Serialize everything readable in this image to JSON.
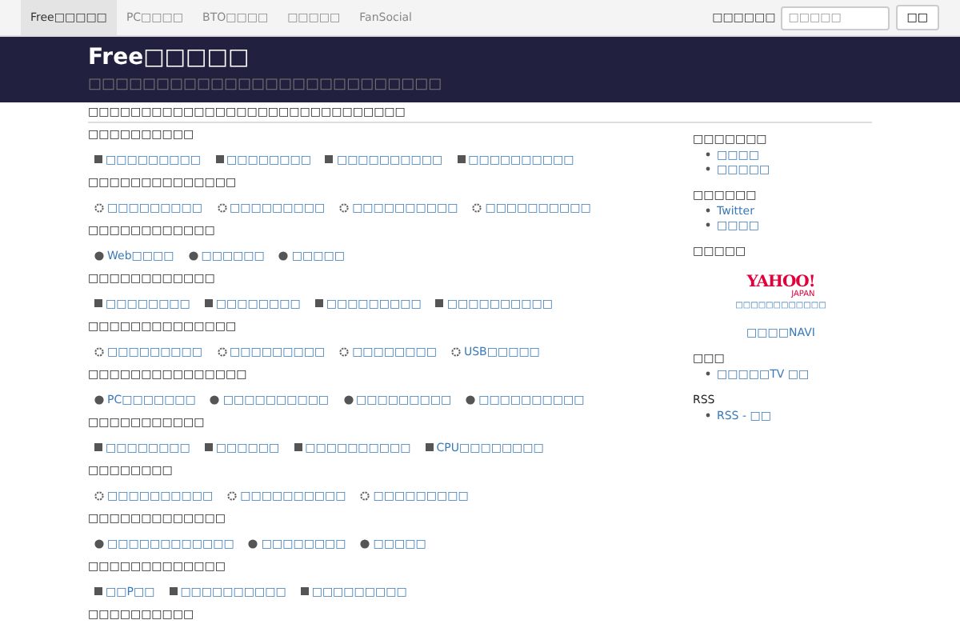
{
  "navbar": {
    "items": [
      {
        "label": "Free□□□□□",
        "selected": true
      },
      {
        "label": "PC□□□□",
        "selected": false
      },
      {
        "label": "BTO□□□□",
        "selected": false
      },
      {
        "label": "□□□□□",
        "selected": false
      },
      {
        "label": "FanSocial",
        "selected": false
      }
    ],
    "search": {
      "label": "□□□□□□",
      "placeholder": "□□□□□",
      "button": "□□"
    }
  },
  "header": {
    "title": "Free□□□□□",
    "subtitle": "□□□□□□□□□□□□□□□□□□□□□□□□□□"
  },
  "tagline": "□□□□□□□□□□□□□□□□□□□□□□□□□□□□□□",
  "sections": [
    {
      "heading": "□□□□□□□□□□",
      "kind": "square",
      "links": [
        "□□□□□□□□□",
        "□□□□□□□□",
        "□□□□□□□□□□",
        "□□□□□□□□□□"
      ]
    },
    {
      "heading": "□□□□□□□□□□□□□□",
      "kind": "ring",
      "links": [
        "□□□□□□□□□",
        "□□□□□□□□□",
        "□□□□□□□□□□",
        "□□□□□□□□□□"
      ]
    },
    {
      "heading": "□□□□□□□□□□□□",
      "kind": "dot",
      "links": [
        "Web□□□□",
        "□□□□□□",
        "□□□□□"
      ]
    },
    {
      "heading": "□□□□□□□□□□□□",
      "kind": "square",
      "links": [
        "□□□□□□□□",
        "□□□□□□□□",
        "□□□□□□□□□",
        "□□□□□□□□□□"
      ]
    },
    {
      "heading": "□□□□□□□□□□□□□□",
      "kind": "ring",
      "links": [
        "□□□□□□□□□",
        "□□□□□□□□□",
        "□□□□□□□□",
        "USB□□□□□"
      ]
    },
    {
      "heading": "□□□□□□□□□□□□□□□",
      "kind": "dot",
      "links": [
        "PC□□□□□□□",
        "□□□□□□□□□□",
        "□□□□□□□□□",
        "□□□□□□□□□□"
      ]
    },
    {
      "heading": "□□□□□□□□□□□",
      "kind": "square",
      "links": [
        "□□□□□□□□",
        "□□□□□□",
        "□□□□□□□□□□",
        "CPU□□□□□□□□"
      ]
    },
    {
      "heading": "□□□□□□□□",
      "kind": "ring",
      "links": [
        "□□□□□□□□□□",
        "□□□□□□□□□□",
        "□□□□□□□□□"
      ]
    },
    {
      "heading": "□□□□□□□□□□□□□",
      "kind": "dot",
      "links": [
        "□□□□□□□□□□□□",
        "□□□□□□□□",
        "□□□□□"
      ]
    },
    {
      "heading": "□□□□□□□□□□□□□",
      "kind": "square",
      "links": [
        "□□P□□",
        "□□□□□□□□□□",
        "□□□□□□□□□"
      ]
    },
    {
      "heading": "□□□□□□□□□□"
    }
  ],
  "sidebar": [
    {
      "kind": "list",
      "title": "□□□□□□□",
      "links": [
        "□□□□",
        "□□□□□"
      ]
    },
    {
      "kind": "list",
      "title": "□□□□□□",
      "links": [
        "Twitter",
        "□□□□"
      ]
    },
    {
      "kind": "banner",
      "title": "□□□□□",
      "logo": "YAHOO!",
      "logo_sub": "JAPAN",
      "caption": "□□□□□□□□□□□□",
      "link": "□□□□NAVI"
    },
    {
      "kind": "list",
      "title": "□□□",
      "links": [
        "□□□□□TV □□"
      ]
    },
    {
      "kind": "list",
      "title": "RSS",
      "links": [
        "RSS - □□"
      ]
    }
  ]
}
